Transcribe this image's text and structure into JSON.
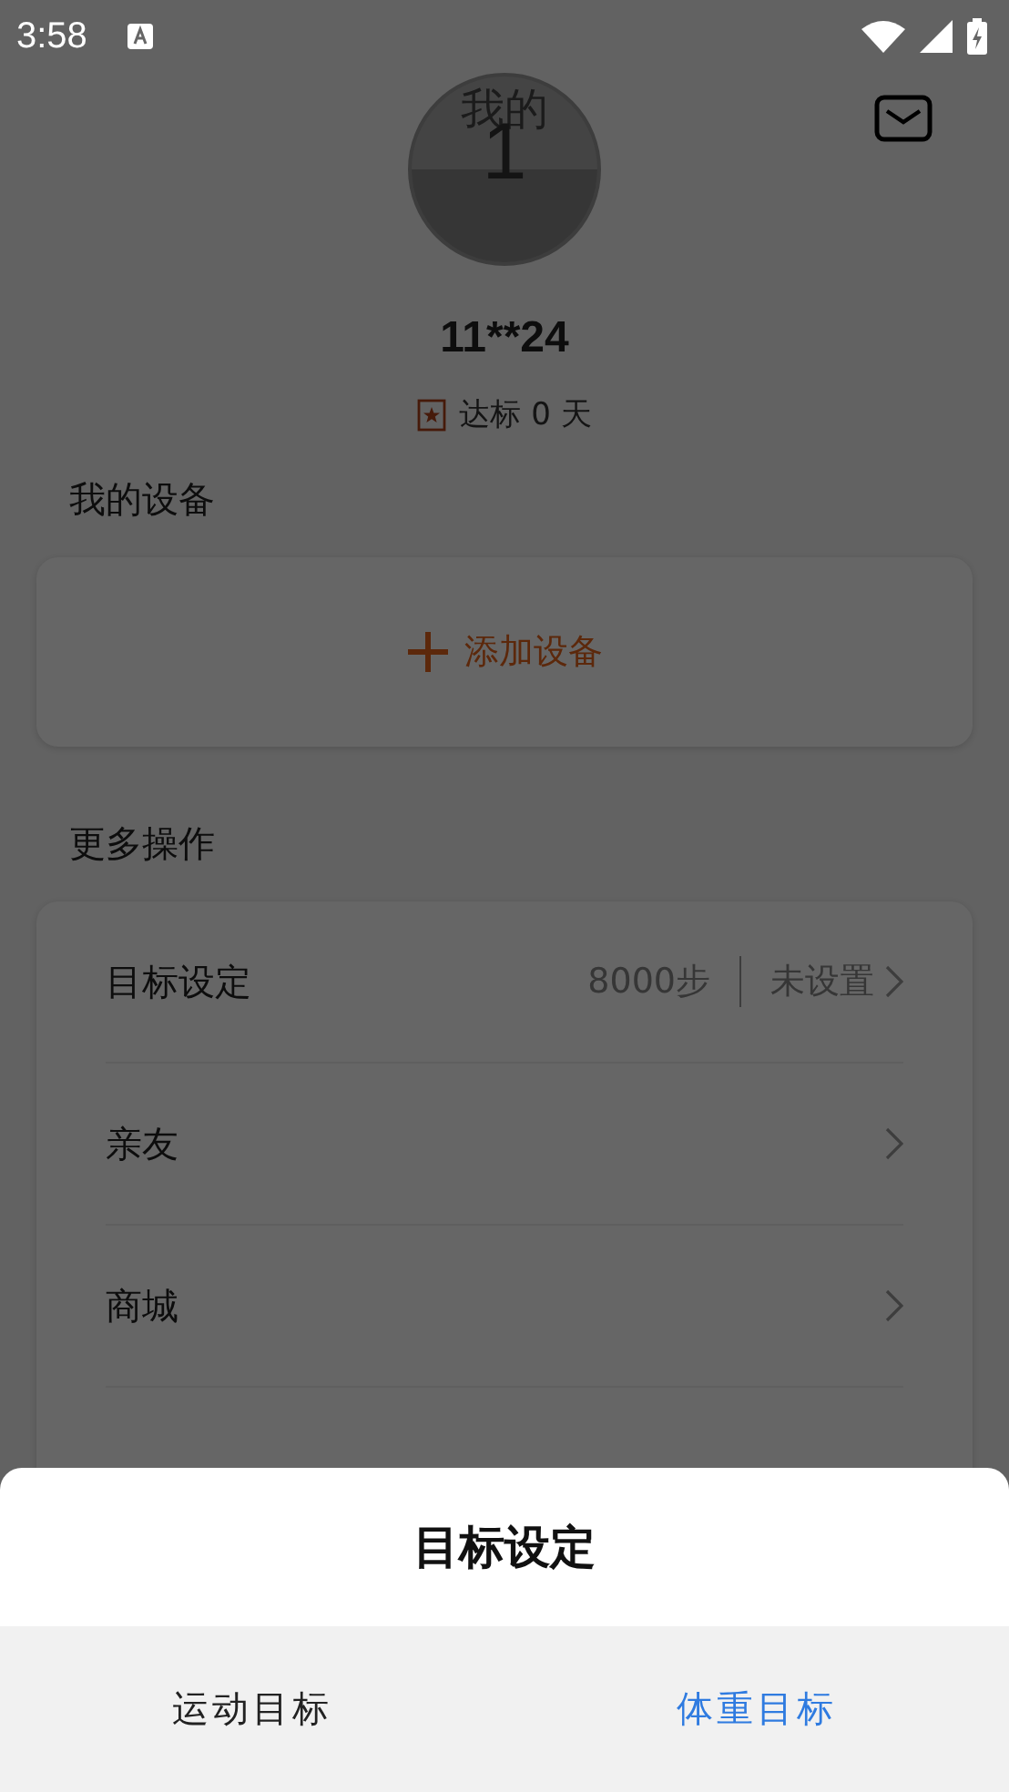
{
  "status_bar": {
    "time": "3:58"
  },
  "profile": {
    "avatar_text": "我的",
    "avatar_number": "1",
    "name": "11**24",
    "badge": "达标 0 天"
  },
  "devices": {
    "title": "我的设备",
    "add_label": "添加设备"
  },
  "more": {
    "title": "更多操作",
    "rows": [
      {
        "label": "目标设定",
        "value": "8000步",
        "secondary": "未设置"
      },
      {
        "label": "亲友"
      },
      {
        "label": "商城"
      }
    ]
  },
  "sheet": {
    "title": "目标设定",
    "options": [
      {
        "label": "运动目标",
        "selected": false
      },
      {
        "label": "体重目标",
        "selected": true
      }
    ]
  }
}
